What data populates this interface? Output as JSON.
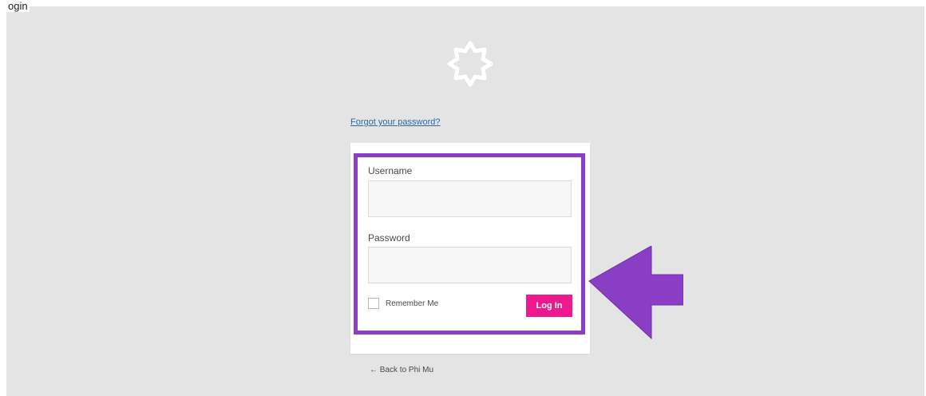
{
  "page": {
    "corner_label": "ogin"
  },
  "logo": {
    "icon": "starburst-logo-icon",
    "color": "#ffffff"
  },
  "links": {
    "forgot_password": "Forgot your password?",
    "back_to_site": "← Back to Phi Mu"
  },
  "form": {
    "username_label": "Username",
    "username_value": "",
    "password_label": "Password",
    "password_value": "",
    "remember_label": "Remember Me",
    "remember_checked": false,
    "submit_label": "Log In"
  },
  "annotations": {
    "highlight_color": "#8a3ec5",
    "arrow_icon": "left-arrow-icon",
    "arrow_color": "#8a3ec5"
  },
  "colors": {
    "background": "#e4e4e4",
    "card": "#ffffff",
    "accent": "#ec1a8c",
    "link": "#2d6a9e"
  }
}
